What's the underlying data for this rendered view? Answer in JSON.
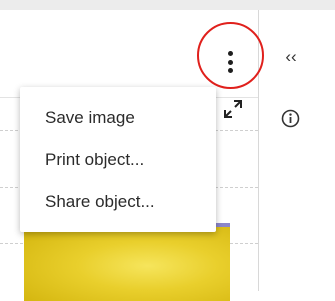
{
  "menu": {
    "items": [
      {
        "label": "Save image"
      },
      {
        "label": "Print object..."
      },
      {
        "label": "Share object..."
      }
    ]
  },
  "icons": {
    "more": "more-vertical-icon",
    "expand": "expand-diagonal-icon",
    "collapse": "double-chevron-left-icon",
    "collapse_glyph": "‹‹",
    "info": "info-circle-icon"
  },
  "colors": {
    "highlight_ring": "#e0201c",
    "chart_fill": "#e9cf2c",
    "chart_top": "#8b86c9"
  }
}
